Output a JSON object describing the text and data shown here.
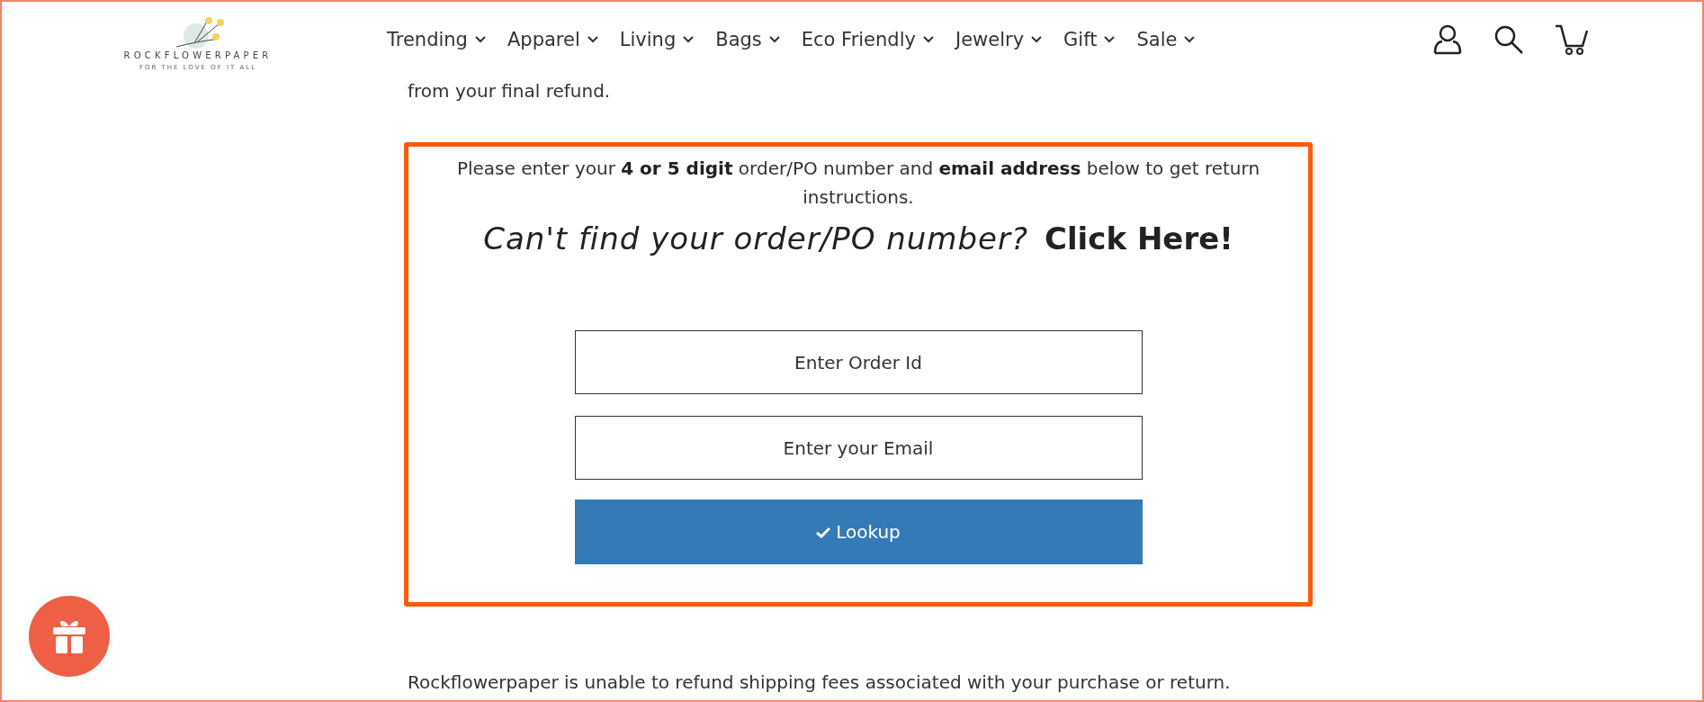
{
  "header": {
    "logo": {
      "name": "ROCKFLOWERPAPER",
      "tagline": "FOR THE LOVE OF IT ALL"
    },
    "nav": [
      {
        "label": "Trending"
      },
      {
        "label": "Apparel"
      },
      {
        "label": "Living"
      },
      {
        "label": "Bags"
      },
      {
        "label": "Eco Friendly"
      },
      {
        "label": "Jewelry"
      },
      {
        "label": "Gift"
      },
      {
        "label": "Sale"
      }
    ]
  },
  "intro_fragment": "from your final refund.",
  "lookup": {
    "instructions": "Please enter your **4 or 5 digit** order/PO number and **email address** below to get return instructions.",
    "question": "Can't find your order/PO number?",
    "link": "Click Here!",
    "fields": [
      {
        "placeholder": "Enter Order Id"
      },
      {
        "placeholder": "Enter your Email"
      }
    ],
    "button": "Lookup"
  },
  "footer_text": "Rockflowerpaper is unable to refund shipping fees associated with your purchase or return."
}
